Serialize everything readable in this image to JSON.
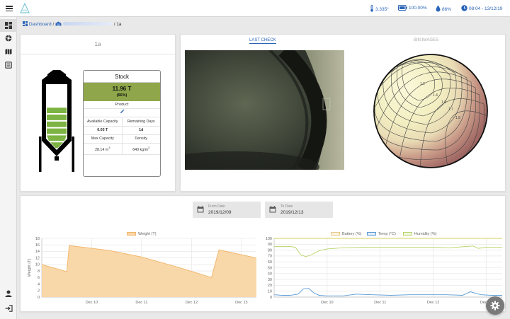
{
  "topbar": {
    "temperature": "3.335°",
    "battery": "100.00%",
    "humidity": "86%",
    "datetime": "08:04 - 13/12/19"
  },
  "breadcrumb": {
    "dashboard": "Dashboard",
    "separator": "/",
    "current": "1a"
  },
  "silo_card": {
    "title": "1a",
    "stock": {
      "heading": "Stock",
      "amount": "11.96 T",
      "percent": "(66%)",
      "product_label": "Product",
      "available_capacity_label": "Available Capacity",
      "remaining_days_label": "Remaining Days",
      "available_capacity": "6.05 T",
      "remaining_days": "1d",
      "max_capacity_label": "Max Capacity",
      "density_label": "Density",
      "max_capacity_value": "28.14 m",
      "max_capacity_unit_sup": "3",
      "density_value": "640 kg/m",
      "density_unit_sup": "3"
    },
    "fill_level": 0.66
  },
  "images_card": {
    "tabs": [
      "LAST CHECK",
      "BIN IMAGES"
    ],
    "active_tab": "LAST CHECK"
  },
  "dates": {
    "from_label": "From Date",
    "from_value": "2019/12/09",
    "to_label": "To Date",
    "to_value": "2019/12/13"
  },
  "colors": {
    "accent": "#2a64b8",
    "stock_green": "#8fa74a",
    "silo_fill": "#7cb342",
    "weight_fill": "#f8d7a8",
    "weight_line": "#f2b468",
    "battery_line": "#d7cf5a",
    "temp_line": "#5b9bd5",
    "humidity_line": "#b8d46a"
  },
  "chart_data": [
    {
      "type": "area",
      "legend": [
        "Weight (T)"
      ],
      "ylabel": "Weight (T)",
      "ylim": [
        0,
        18
      ],
      "yticks": [
        0,
        2,
        4,
        6,
        8,
        10,
        12,
        14,
        16,
        18
      ],
      "xticks": [
        "Dec 10",
        "Dec 11",
        "Dec 12",
        "Dec 13"
      ],
      "xrange": [
        9.0,
        13.3
      ],
      "series": [
        {
          "name": "Weight (T)",
          "x": [
            9.0,
            9.5,
            9.55,
            10.35,
            11.0,
            11.7,
            12.4,
            12.55,
            13.3
          ],
          "values": [
            10.0,
            7.8,
            15.8,
            14.3,
            12.3,
            9.3,
            6.0,
            14.5,
            12.0
          ]
        }
      ]
    },
    {
      "type": "line",
      "legend": [
        "Battery (%)",
        "Temp (°C)",
        "Humidity (%)"
      ],
      "ylim": [
        0,
        100
      ],
      "yticks": [
        0,
        10,
        20,
        30,
        40,
        50,
        60,
        70,
        80,
        90,
        100
      ],
      "xticks": [
        "Dec 10",
        "Dec 11",
        "Dec 12",
        "Dec 13"
      ],
      "xrange": [
        9.0,
        13.3
      ],
      "series": [
        {
          "name": "Battery (%)",
          "x": [
            9.0,
            13.3
          ],
          "values": [
            100,
            100
          ]
        },
        {
          "name": "Temp (°C)",
          "x": [
            9.0,
            9.15,
            9.3,
            9.45,
            9.55,
            9.65,
            9.75,
            9.85,
            10.0,
            10.3,
            10.55,
            10.85,
            11.2,
            11.55,
            11.9,
            12.25,
            12.55,
            12.7,
            12.9,
            13.1,
            13.3
          ],
          "values": [
            4,
            3,
            3,
            5,
            14,
            15,
            7,
            3,
            2,
            2,
            5,
            4,
            3,
            4,
            4,
            4,
            3,
            9,
            4,
            3,
            3
          ]
        },
        {
          "name": "Humidity (%)",
          "x": [
            9.0,
            9.3,
            9.4,
            9.5,
            9.6,
            9.7,
            9.85,
            10.0,
            10.3,
            10.7,
            11.2,
            11.6,
            12.0,
            12.3,
            12.6,
            12.75,
            12.85,
            13.0,
            13.3
          ],
          "values": [
            86,
            86,
            85,
            72,
            69,
            72,
            79,
            82,
            84,
            85,
            85,
            85,
            85,
            84,
            86,
            87,
            83,
            85,
            85
          ]
        }
      ]
    }
  ]
}
